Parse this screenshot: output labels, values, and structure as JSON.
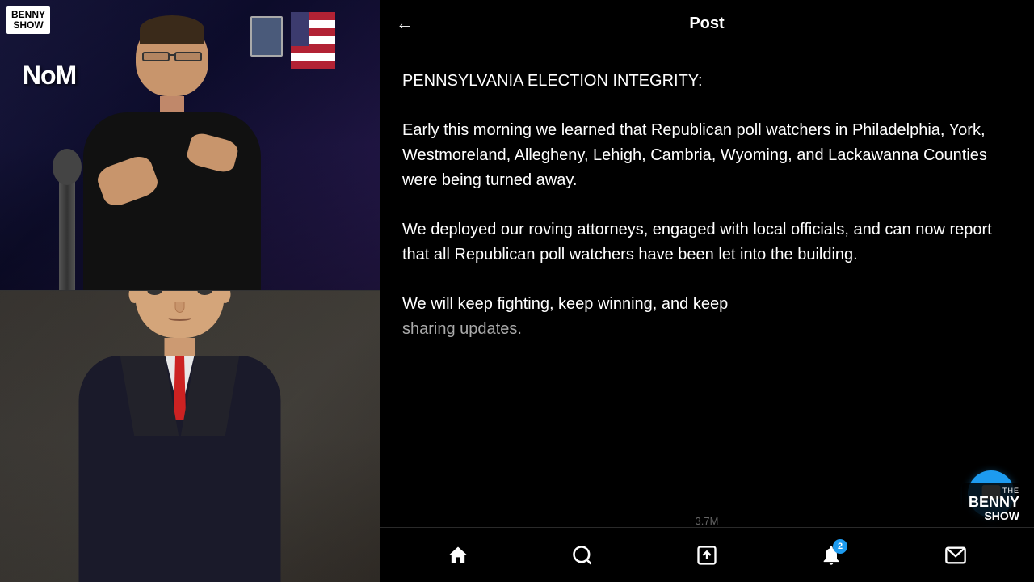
{
  "header": {
    "title": "Post",
    "back_icon": "←"
  },
  "post": {
    "paragraph1": "PENNSYLVANIA ELECTION INTEGRITY:",
    "paragraph2": "Early this morning we learned that Republican poll watchers in Philadelphia, York, Westmoreland, Allegheny, Lehigh, Cambria, Wyoming, and Lackawanna Counties were being turned away.",
    "paragraph3": "We deployed our roving attorneys, engaged with local officials, and can now report that all Republican poll watchers have been let into the building.",
    "paragraph4_start": "We will keep fighting, keep winning, and keep",
    "paragraph4_end": "sharing updates."
  },
  "benny_show_top": {
    "line1": "BENNY",
    "line2": "SHOW"
  },
  "benny_show_bottom": {
    "the": "THE",
    "benny": "BENNY",
    "show": "SHOW"
  },
  "nav": {
    "home_icon": "⌂",
    "search_icon": "🔍",
    "compose_icon": "✏",
    "notifications_icon": "🔔",
    "notification_badge": "2",
    "messages_icon": "✉"
  },
  "stat": {
    "value": "3.7M"
  },
  "nom_text": "NoM",
  "float_btn": {
    "icon": "💬"
  }
}
